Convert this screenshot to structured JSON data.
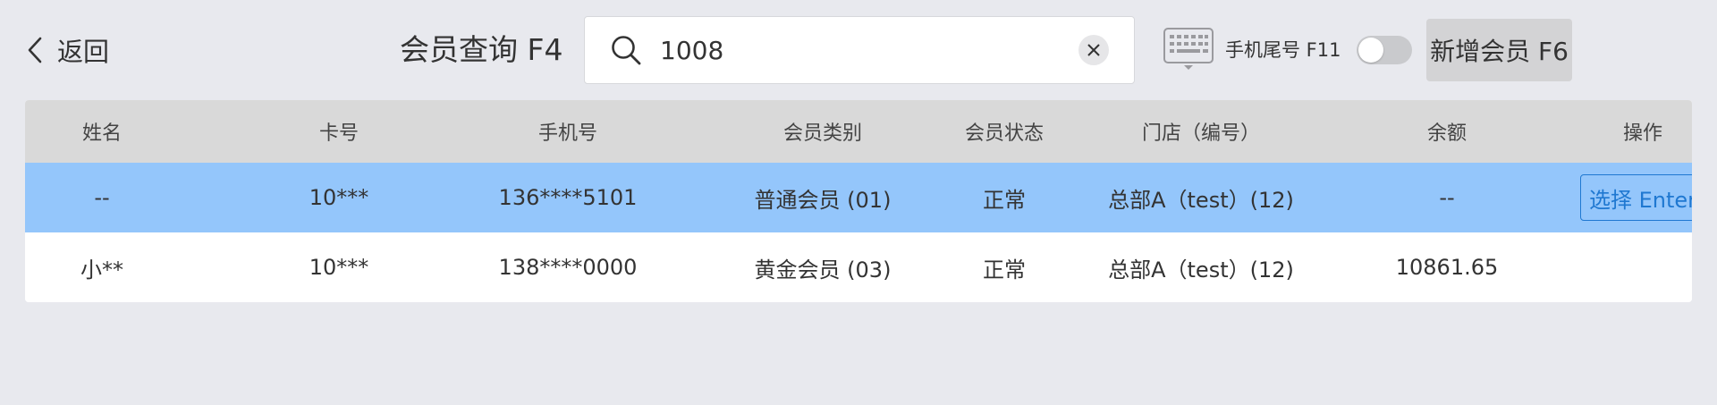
{
  "header": {
    "back_label": "返回",
    "title": "会员查询 F4",
    "search_value": "1008",
    "phone_tail_label": "手机尾号 F11",
    "phone_tail_enabled": false,
    "new_member_label": "新增会员 F6"
  },
  "table": {
    "columns": [
      "姓名",
      "卡号",
      "手机号",
      "会员类别",
      "会员状态",
      "门店（编号）",
      "余额",
      "操作"
    ],
    "rows": [
      {
        "name": "--",
        "card": "10***",
        "phone": "136****5101",
        "type": "普通会员 (01)",
        "status": "正常",
        "store": "总部A（test）(12)",
        "balance": "--",
        "action": "选择 Enter",
        "selected": true
      },
      {
        "name": "小**",
        "card": "10***",
        "phone": "138****0000",
        "type": "黄金会员 (03)",
        "status": "正常",
        "store": "总部A（test）(12)",
        "balance": "10861.65",
        "action": "",
        "selected": false
      }
    ]
  },
  "colors": {
    "background": "#e8e9ee",
    "header_row": "#d9d9d9",
    "selected_row": "#94c6fb",
    "accent": "#1f78d1"
  },
  "icons": {
    "back": "chevron-left-icon",
    "search": "search-icon",
    "clear": "close-circle-icon",
    "keyboard": "keyboard-icon"
  }
}
